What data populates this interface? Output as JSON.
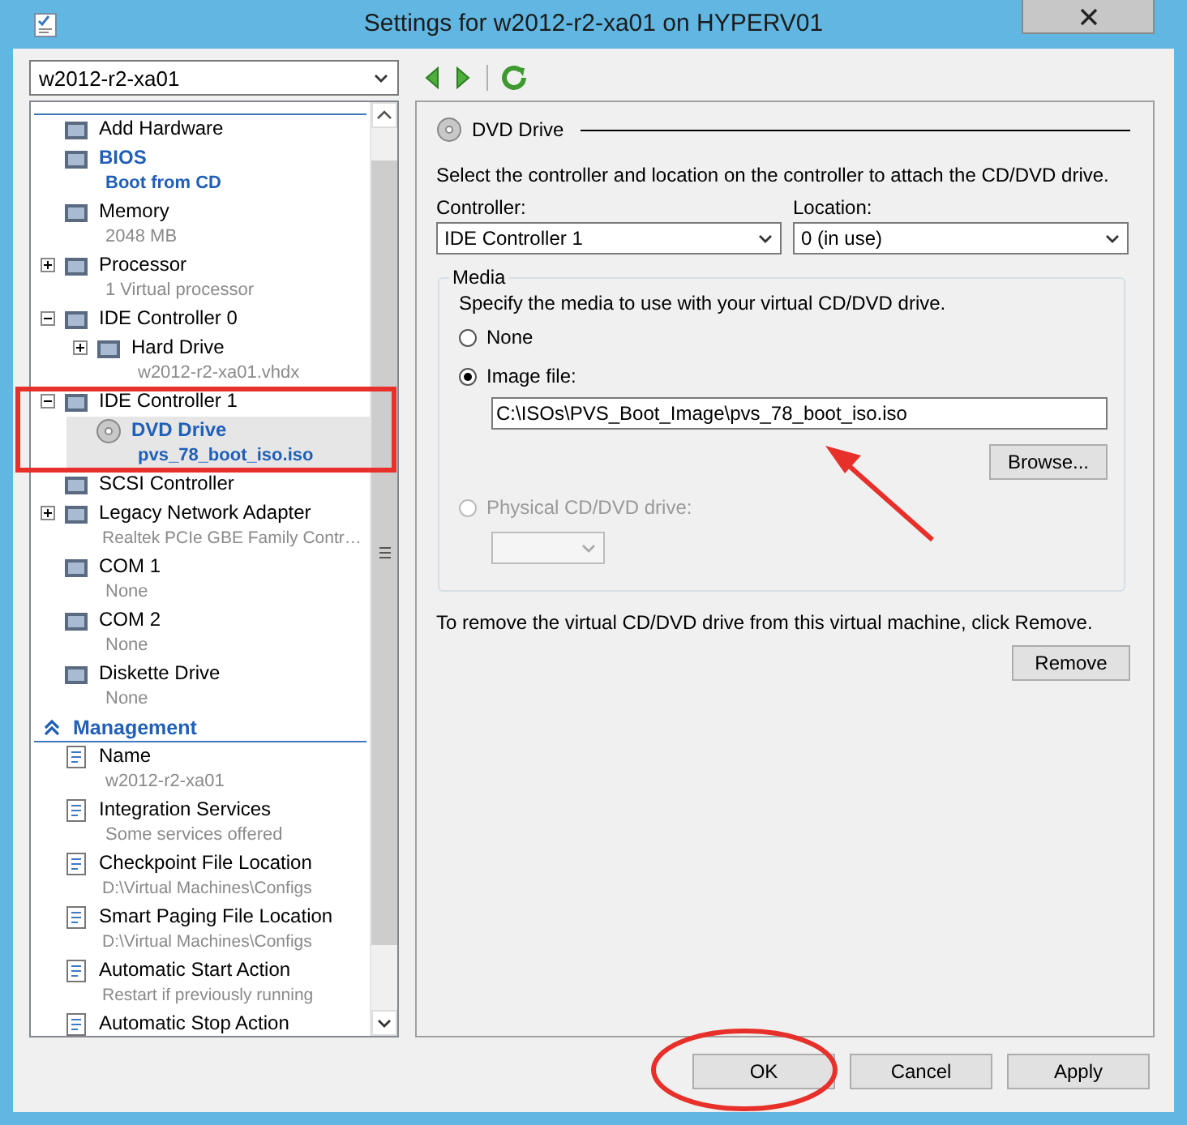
{
  "window": {
    "title": "Settings for w2012-r2-xa01 on HYPERV01"
  },
  "vm_selector": {
    "value": "w2012-r2-xa01"
  },
  "tree": {
    "sections": [
      {
        "items": [
          {
            "label": "Add Hardware",
            "kind": "leaf",
            "highlighted": false,
            "selected": false
          },
          {
            "label": "BIOS",
            "detail": "Boot from CD",
            "kind": "leaf",
            "highlighted": true,
            "selected": false
          },
          {
            "label": "Memory",
            "detail": "2048 MB",
            "kind": "leaf",
            "highlighted": false,
            "selected": false
          },
          {
            "label": "Processor",
            "detail": "1 Virtual processor",
            "kind": "expandable",
            "expanded": false,
            "highlighted": false,
            "selected": false
          },
          {
            "label": "IDE Controller 0",
            "kind": "expandable",
            "expanded": true,
            "highlighted": false,
            "selected": false,
            "children": [
              {
                "label": "Hard Drive",
                "detail": "w2012-r2-xa01.vhdx",
                "kind": "expandable",
                "expanded": false,
                "highlighted": false,
                "selected": false
              }
            ]
          },
          {
            "label": "IDE Controller 1",
            "kind": "expandable",
            "expanded": true,
            "highlighted": false,
            "selected": false,
            "children": [
              {
                "label": "DVD Drive",
                "detail": "pvs_78_boot_iso.iso",
                "kind": "leaf",
                "highlighted": true,
                "selected": true
              }
            ]
          },
          {
            "label": "SCSI Controller",
            "kind": "leaf",
            "highlighted": false,
            "selected": false
          },
          {
            "label": "Legacy Network Adapter",
            "detail": "Realtek PCIe GBE Family Contr…",
            "kind": "expandable",
            "expanded": false,
            "highlighted": false,
            "selected": false
          },
          {
            "label": "COM 1",
            "detail": "None",
            "kind": "leaf",
            "highlighted": false,
            "selected": false
          },
          {
            "label": "COM 2",
            "detail": "None",
            "kind": "leaf",
            "highlighted": false,
            "selected": false
          },
          {
            "label": "Diskette Drive",
            "detail": "None",
            "kind": "leaf",
            "highlighted": false,
            "selected": false
          }
        ]
      },
      {
        "title": "Management",
        "expanded": true,
        "items": [
          {
            "label": "Name",
            "detail": "w2012-r2-xa01",
            "kind": "leaf",
            "highlighted": false,
            "selected": false
          },
          {
            "label": "Integration Services",
            "detail": "Some services offered",
            "kind": "leaf",
            "highlighted": false,
            "selected": false
          },
          {
            "label": "Checkpoint File Location",
            "detail": "D:\\Virtual Machines\\Configs",
            "kind": "leaf",
            "highlighted": false,
            "selected": false
          },
          {
            "label": "Smart Paging File Location",
            "detail": "D:\\Virtual Machines\\Configs",
            "kind": "leaf",
            "highlighted": false,
            "selected": false
          },
          {
            "label": "Automatic Start Action",
            "detail": "Restart if previously running",
            "kind": "leaf",
            "highlighted": false,
            "selected": false
          },
          {
            "label": "Automatic Stop Action",
            "kind": "leaf",
            "highlighted": false,
            "selected": false
          }
        ]
      }
    ]
  },
  "details": {
    "heading": "DVD Drive",
    "description": "Select the controller and location on the controller to attach the CD/DVD drive.",
    "controller": {
      "label": "Controller:",
      "value": "IDE Controller 1"
    },
    "location": {
      "label": "Location:",
      "value": "0 (in use)"
    },
    "media": {
      "legend": "Media",
      "description": "Specify the media to use with your virtual CD/DVD drive.",
      "options": [
        {
          "kind": "plain",
          "label": "None",
          "selected": false,
          "disabled": false
        },
        {
          "kind": "file",
          "label": "Image file:",
          "selected": true,
          "disabled": false,
          "path": "C:\\ISOs\\PVS_Boot_Image\\pvs_78_boot_iso.iso",
          "button": "Browse..."
        },
        {
          "kind": "drive",
          "label": "Physical CD/DVD drive:",
          "selected": false,
          "disabled": true
        }
      ]
    },
    "remove_hint": "To remove the virtual CD/DVD drive from this virtual machine, click Remove.",
    "remove_button": "Remove"
  },
  "buttons": [
    "OK",
    "Cancel",
    "Apply"
  ],
  "annotations": [
    {
      "kind": "box"
    },
    {
      "kind": "arrow"
    },
    {
      "kind": "ellipse"
    }
  ]
}
